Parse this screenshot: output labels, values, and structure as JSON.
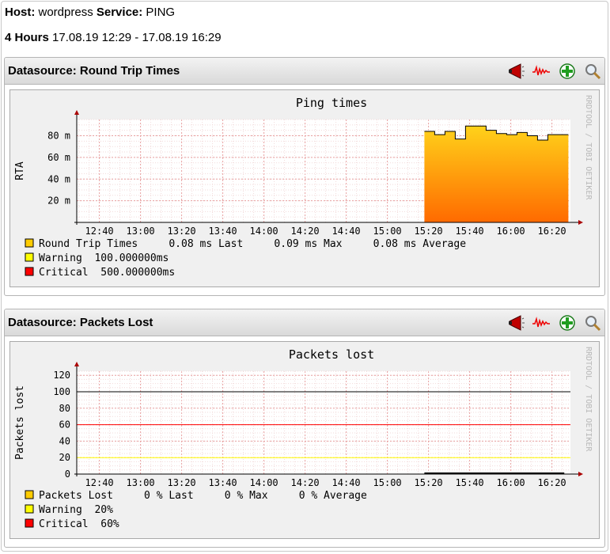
{
  "header": {
    "host_label": "Host:",
    "host_value": "wordpress",
    "service_label": "Service:",
    "service_value": "PING",
    "period_label": "4 Hours",
    "period_value": "17.08.19 12:29 - 17.08.19 16:29"
  },
  "icons": [
    "megaphone-icon",
    "waveform-icon",
    "add-icon",
    "zoom-icon"
  ],
  "panels": [
    {
      "title": "Datasource: Round Trip Times"
    },
    {
      "title": "Datasource: Packets Lost"
    }
  ],
  "watermark": "RRDTOOL / TOBI OETIKER",
  "chart_data": [
    {
      "type": "area",
      "title": "Ping times",
      "ylabel": "RTA",
      "xlabel": "",
      "x_ticks": [
        "12:40",
        "13:00",
        "13:20",
        "13:40",
        "14:00",
        "14:20",
        "14:40",
        "15:00",
        "15:20",
        "15:40",
        "16:00",
        "16:20"
      ],
      "y_ticks": [
        {
          "v": 20,
          "label": "20 m"
        },
        {
          "v": 40,
          "label": "40 m"
        },
        {
          "v": 60,
          "label": "60 m"
        },
        {
          "v": 80,
          "label": "80 m"
        }
      ],
      "xlim": [
        "12:29",
        "16:29"
      ],
      "ylim": [
        0,
        95
      ],
      "series": [
        {
          "name": "Round Trip Times",
          "color": "#FFCC00",
          "x": [
            "15:18",
            "15:23",
            "15:28",
            "15:33",
            "15:38",
            "15:43",
            "15:48",
            "15:53",
            "15:58",
            "16:03",
            "16:08",
            "16:13",
            "16:18",
            "16:23"
          ],
          "values": [
            84,
            81,
            84,
            77,
            89,
            89,
            85,
            82,
            81,
            83,
            80,
            76,
            81,
            81
          ]
        }
      ],
      "legend": [
        {
          "name": "Round Trip Times",
          "color": "#FFCC00",
          "stats": "0.08 ms Last     0.09 ms Max     0.08 ms Average"
        },
        {
          "name": "Warning",
          "color": "#FFFF00",
          "stats": "100.000000ms"
        },
        {
          "name": "Critical",
          "color": "#FF0000",
          "stats": "500.000000ms"
        }
      ],
      "grid": true
    },
    {
      "type": "line",
      "title": "Packets lost",
      "ylabel": "Packets lost",
      "xlabel": "",
      "x_ticks": [
        "12:40",
        "13:00",
        "13:20",
        "13:40",
        "14:00",
        "14:20",
        "14:40",
        "15:00",
        "15:20",
        "15:40",
        "16:00",
        "16:20"
      ],
      "y_ticks": [
        {
          "v": 0,
          "label": "0"
        },
        {
          "v": 20,
          "label": "20"
        },
        {
          "v": 40,
          "label": "40"
        },
        {
          "v": 60,
          "label": "60"
        },
        {
          "v": 80,
          "label": "80"
        },
        {
          "v": 100,
          "label": "100"
        },
        {
          "v": 120,
          "label": "120"
        }
      ],
      "xlim": [
        "12:29",
        "16:29"
      ],
      "ylim": [
        0,
        125
      ],
      "hlines": [
        {
          "value": 100,
          "color": "#000000"
        },
        {
          "value": 60,
          "color": "#FF0000"
        },
        {
          "value": 20,
          "color": "#FFFF00"
        }
      ],
      "series": [
        {
          "name": "Packets Lost",
          "color": "#000000",
          "x": [
            "15:18",
            "16:26"
          ],
          "values": [
            0,
            0
          ]
        }
      ],
      "legend": [
        {
          "name": "Packets Lost",
          "color": "#FFCC00",
          "stats": "0 % Last     0 % Max     0 % Average"
        },
        {
          "name": "Warning",
          "color": "#FFFF00",
          "stats": "20%"
        },
        {
          "name": "Critical",
          "color": "#FF0000",
          "stats": "60%"
        }
      ],
      "grid": true
    }
  ]
}
